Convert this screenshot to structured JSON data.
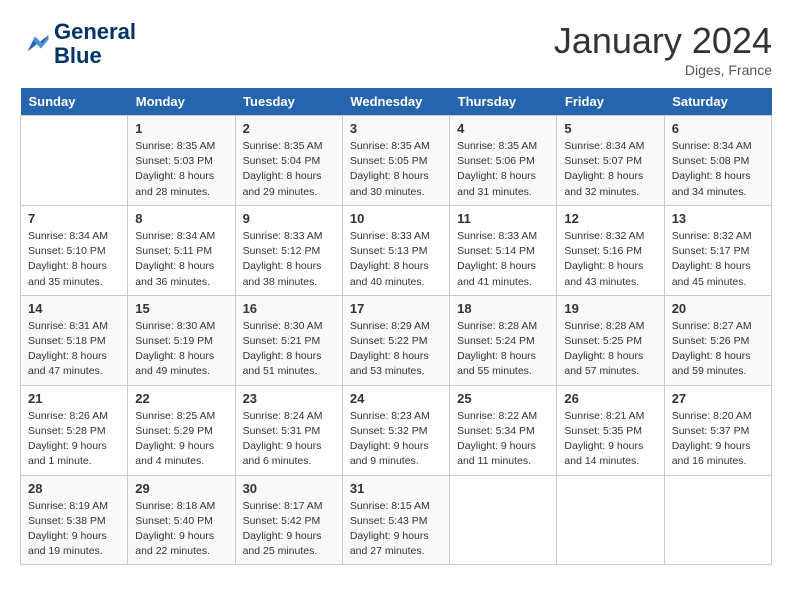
{
  "header": {
    "logo_line1": "General",
    "logo_line2": "Blue",
    "month_title": "January 2024",
    "location": "Diges, France"
  },
  "days_of_week": [
    "Sunday",
    "Monday",
    "Tuesday",
    "Wednesday",
    "Thursday",
    "Friday",
    "Saturday"
  ],
  "weeks": [
    [
      {
        "day": "",
        "sunrise": "",
        "sunset": "",
        "daylight": ""
      },
      {
        "day": "1",
        "sunrise": "8:35 AM",
        "sunset": "5:03 PM",
        "daylight": "8 hours and 28 minutes."
      },
      {
        "day": "2",
        "sunrise": "8:35 AM",
        "sunset": "5:04 PM",
        "daylight": "8 hours and 29 minutes."
      },
      {
        "day": "3",
        "sunrise": "8:35 AM",
        "sunset": "5:05 PM",
        "daylight": "8 hours and 30 minutes."
      },
      {
        "day": "4",
        "sunrise": "8:35 AM",
        "sunset": "5:06 PM",
        "daylight": "8 hours and 31 minutes."
      },
      {
        "day": "5",
        "sunrise": "8:34 AM",
        "sunset": "5:07 PM",
        "daylight": "8 hours and 32 minutes."
      },
      {
        "day": "6",
        "sunrise": "8:34 AM",
        "sunset": "5:08 PM",
        "daylight": "8 hours and 34 minutes."
      }
    ],
    [
      {
        "day": "7",
        "sunrise": "8:34 AM",
        "sunset": "5:10 PM",
        "daylight": "8 hours and 35 minutes."
      },
      {
        "day": "8",
        "sunrise": "8:34 AM",
        "sunset": "5:11 PM",
        "daylight": "8 hours and 36 minutes."
      },
      {
        "day": "9",
        "sunrise": "8:33 AM",
        "sunset": "5:12 PM",
        "daylight": "8 hours and 38 minutes."
      },
      {
        "day": "10",
        "sunrise": "8:33 AM",
        "sunset": "5:13 PM",
        "daylight": "8 hours and 40 minutes."
      },
      {
        "day": "11",
        "sunrise": "8:33 AM",
        "sunset": "5:14 PM",
        "daylight": "8 hours and 41 minutes."
      },
      {
        "day": "12",
        "sunrise": "8:32 AM",
        "sunset": "5:16 PM",
        "daylight": "8 hours and 43 minutes."
      },
      {
        "day": "13",
        "sunrise": "8:32 AM",
        "sunset": "5:17 PM",
        "daylight": "8 hours and 45 minutes."
      }
    ],
    [
      {
        "day": "14",
        "sunrise": "8:31 AM",
        "sunset": "5:18 PM",
        "daylight": "8 hours and 47 minutes."
      },
      {
        "day": "15",
        "sunrise": "8:30 AM",
        "sunset": "5:19 PM",
        "daylight": "8 hours and 49 minutes."
      },
      {
        "day": "16",
        "sunrise": "8:30 AM",
        "sunset": "5:21 PM",
        "daylight": "8 hours and 51 minutes."
      },
      {
        "day": "17",
        "sunrise": "8:29 AM",
        "sunset": "5:22 PM",
        "daylight": "8 hours and 53 minutes."
      },
      {
        "day": "18",
        "sunrise": "8:28 AM",
        "sunset": "5:24 PM",
        "daylight": "8 hours and 55 minutes."
      },
      {
        "day": "19",
        "sunrise": "8:28 AM",
        "sunset": "5:25 PM",
        "daylight": "8 hours and 57 minutes."
      },
      {
        "day": "20",
        "sunrise": "8:27 AM",
        "sunset": "5:26 PM",
        "daylight": "8 hours and 59 minutes."
      }
    ],
    [
      {
        "day": "21",
        "sunrise": "8:26 AM",
        "sunset": "5:28 PM",
        "daylight": "9 hours and 1 minute."
      },
      {
        "day": "22",
        "sunrise": "8:25 AM",
        "sunset": "5:29 PM",
        "daylight": "9 hours and 4 minutes."
      },
      {
        "day": "23",
        "sunrise": "8:24 AM",
        "sunset": "5:31 PM",
        "daylight": "9 hours and 6 minutes."
      },
      {
        "day": "24",
        "sunrise": "8:23 AM",
        "sunset": "5:32 PM",
        "daylight": "9 hours and 9 minutes."
      },
      {
        "day": "25",
        "sunrise": "8:22 AM",
        "sunset": "5:34 PM",
        "daylight": "9 hours and 11 minutes."
      },
      {
        "day": "26",
        "sunrise": "8:21 AM",
        "sunset": "5:35 PM",
        "daylight": "9 hours and 14 minutes."
      },
      {
        "day": "27",
        "sunrise": "8:20 AM",
        "sunset": "5:37 PM",
        "daylight": "9 hours and 16 minutes."
      }
    ],
    [
      {
        "day": "28",
        "sunrise": "8:19 AM",
        "sunset": "5:38 PM",
        "daylight": "9 hours and 19 minutes."
      },
      {
        "day": "29",
        "sunrise": "8:18 AM",
        "sunset": "5:40 PM",
        "daylight": "9 hours and 22 minutes."
      },
      {
        "day": "30",
        "sunrise": "8:17 AM",
        "sunset": "5:42 PM",
        "daylight": "9 hours and 25 minutes."
      },
      {
        "day": "31",
        "sunrise": "8:15 AM",
        "sunset": "5:43 PM",
        "daylight": "9 hours and 27 minutes."
      },
      {
        "day": "",
        "sunrise": "",
        "sunset": "",
        "daylight": ""
      },
      {
        "day": "",
        "sunrise": "",
        "sunset": "",
        "daylight": ""
      },
      {
        "day": "",
        "sunrise": "",
        "sunset": "",
        "daylight": ""
      }
    ]
  ]
}
